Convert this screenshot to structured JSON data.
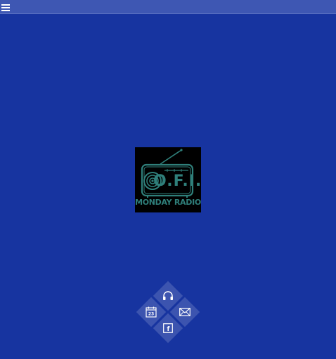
{
  "colors": {
    "background": "#1734a0",
    "topbar": "#3e57b3",
    "logo_background": "#000000",
    "logo_accent": "#2f7f7a",
    "tile_icon": "#ffffff"
  },
  "topbar": {
    "menu_icon": "hamburger-menu-icon"
  },
  "logo": {
    "brand": "O.F.I.",
    "subtitle": "MONDAY RADIO"
  },
  "nav": {
    "listen": {
      "icon": "headphones-icon"
    },
    "schedule": {
      "icon": "calendar-icon",
      "day": "23"
    },
    "contact": {
      "icon": "envelope-icon"
    },
    "facebook": {
      "icon": "facebook-icon",
      "glyph": "f"
    }
  }
}
